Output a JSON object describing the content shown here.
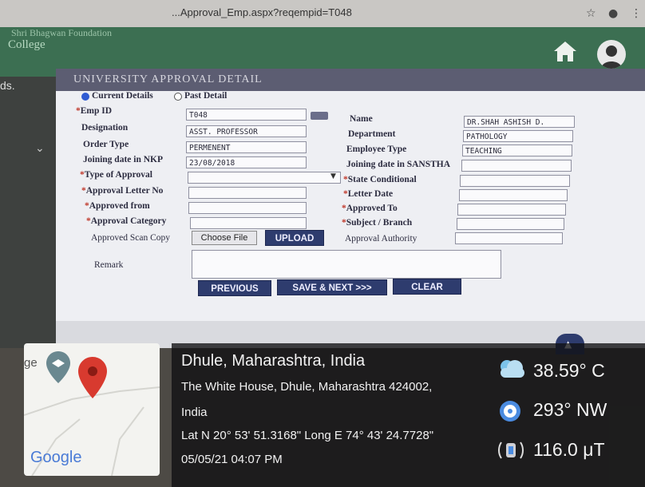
{
  "browser": {
    "url": "...Approval_Emp.aspx?reqempid=T048",
    "star_icon": "star-icon",
    "profile_icon": "profile-icon",
    "menu_icon": "menu-icon"
  },
  "header": {
    "org_line1": "Shri Bhagwan Foundation",
    "org_line2": "College"
  },
  "sidebar": {
    "label": "ds."
  },
  "panel": {
    "title": "UNIVERSITY APPROVAL DETAIL",
    "radio_current": "Current Details",
    "radio_past": "Past Detail",
    "emp_id_label": "Emp ID",
    "emp_id_value": "T048",
    "designation_label": "Designation",
    "designation_value": "ASST. PROFESSOR",
    "order_type_label": "Order Type",
    "order_type_value": "PERMENENT",
    "joining_nkp_label": "Joining date in NKP",
    "joining_nkp_value": "23/08/2018",
    "type_approval_label": "Type of Approval",
    "approval_letter_label": "Approval Letter No",
    "approved_from_label": "Approved from",
    "approval_category_label": "Approval Category",
    "approved_scan_label": "Approved Scan Copy",
    "choose_file_label": "Choose File",
    "upload_label": "UPLOAD",
    "remark_label": "Remark",
    "name_label": "Name",
    "name_value": "DR.SHAH ASHISH D.",
    "department_label": "Department",
    "department_value": "PATHOLOGY",
    "employee_type_label": "Employee Type",
    "employee_type_value": "TEACHING",
    "joining_sanstha_label": "Joining date in SANSTHA",
    "state_conditional_label": "State Conditional",
    "letter_date_label": "Letter Date",
    "approved_to_label": "Approved To",
    "subject_branch_label": "Subject / Branch",
    "approval_authority_label": "Approval Authority",
    "previous_label": "PREVIOUS",
    "save_next_label": "SAVE & NEXT >>>",
    "clear_label": "CLEAR"
  },
  "overlay": {
    "map_label": "ge",
    "google_label": "Google",
    "location_title": "Dhule, Maharashtra, India",
    "address_line1": "The White House, Dhule, Maharashtra 424002,",
    "address_line2": "India",
    "coords": "Lat N 20° 53' 51.3168\" Long E 74° 43' 24.7728\"",
    "datetime": "05/05/21 04:07 PM",
    "temperature": "38.59° C",
    "wind": "293° NW",
    "magnetic": "116.0 μT"
  }
}
